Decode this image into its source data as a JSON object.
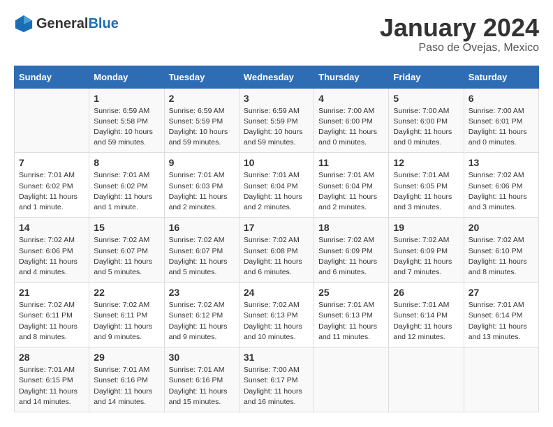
{
  "logo": {
    "general": "General",
    "blue": "Blue"
  },
  "title": "January 2024",
  "location": "Paso de Ovejas, Mexico",
  "weekdays": [
    "Sunday",
    "Monday",
    "Tuesday",
    "Wednesday",
    "Thursday",
    "Friday",
    "Saturday"
  ],
  "weeks": [
    [
      {
        "day": "",
        "info": ""
      },
      {
        "day": "1",
        "info": "Sunrise: 6:59 AM\nSunset: 5:58 PM\nDaylight: 10 hours\nand 59 minutes."
      },
      {
        "day": "2",
        "info": "Sunrise: 6:59 AM\nSunset: 5:59 PM\nDaylight: 10 hours\nand 59 minutes."
      },
      {
        "day": "3",
        "info": "Sunrise: 6:59 AM\nSunset: 5:59 PM\nDaylight: 10 hours\nand 59 minutes."
      },
      {
        "day": "4",
        "info": "Sunrise: 7:00 AM\nSunset: 6:00 PM\nDaylight: 11 hours\nand 0 minutes."
      },
      {
        "day": "5",
        "info": "Sunrise: 7:00 AM\nSunset: 6:00 PM\nDaylight: 11 hours\nand 0 minutes."
      },
      {
        "day": "6",
        "info": "Sunrise: 7:00 AM\nSunset: 6:01 PM\nDaylight: 11 hours\nand 0 minutes."
      }
    ],
    [
      {
        "day": "7",
        "info": "Sunrise: 7:01 AM\nSunset: 6:02 PM\nDaylight: 11 hours\nand 1 minute."
      },
      {
        "day": "8",
        "info": "Sunrise: 7:01 AM\nSunset: 6:02 PM\nDaylight: 11 hours\nand 1 minute."
      },
      {
        "day": "9",
        "info": "Sunrise: 7:01 AM\nSunset: 6:03 PM\nDaylight: 11 hours\nand 2 minutes."
      },
      {
        "day": "10",
        "info": "Sunrise: 7:01 AM\nSunset: 6:04 PM\nDaylight: 11 hours\nand 2 minutes."
      },
      {
        "day": "11",
        "info": "Sunrise: 7:01 AM\nSunset: 6:04 PM\nDaylight: 11 hours\nand 2 minutes."
      },
      {
        "day": "12",
        "info": "Sunrise: 7:01 AM\nSunset: 6:05 PM\nDaylight: 11 hours\nand 3 minutes."
      },
      {
        "day": "13",
        "info": "Sunrise: 7:02 AM\nSunset: 6:06 PM\nDaylight: 11 hours\nand 3 minutes."
      }
    ],
    [
      {
        "day": "14",
        "info": "Sunrise: 7:02 AM\nSunset: 6:06 PM\nDaylight: 11 hours\nand 4 minutes."
      },
      {
        "day": "15",
        "info": "Sunrise: 7:02 AM\nSunset: 6:07 PM\nDaylight: 11 hours\nand 5 minutes."
      },
      {
        "day": "16",
        "info": "Sunrise: 7:02 AM\nSunset: 6:07 PM\nDaylight: 11 hours\nand 5 minutes."
      },
      {
        "day": "17",
        "info": "Sunrise: 7:02 AM\nSunset: 6:08 PM\nDaylight: 11 hours\nand 6 minutes."
      },
      {
        "day": "18",
        "info": "Sunrise: 7:02 AM\nSunset: 6:09 PM\nDaylight: 11 hours\nand 6 minutes."
      },
      {
        "day": "19",
        "info": "Sunrise: 7:02 AM\nSunset: 6:09 PM\nDaylight: 11 hours\nand 7 minutes."
      },
      {
        "day": "20",
        "info": "Sunrise: 7:02 AM\nSunset: 6:10 PM\nDaylight: 11 hours\nand 8 minutes."
      }
    ],
    [
      {
        "day": "21",
        "info": "Sunrise: 7:02 AM\nSunset: 6:11 PM\nDaylight: 11 hours\nand 8 minutes."
      },
      {
        "day": "22",
        "info": "Sunrise: 7:02 AM\nSunset: 6:11 PM\nDaylight: 11 hours\nand 9 minutes."
      },
      {
        "day": "23",
        "info": "Sunrise: 7:02 AM\nSunset: 6:12 PM\nDaylight: 11 hours\nand 9 minutes."
      },
      {
        "day": "24",
        "info": "Sunrise: 7:02 AM\nSunset: 6:13 PM\nDaylight: 11 hours\nand 10 minutes."
      },
      {
        "day": "25",
        "info": "Sunrise: 7:01 AM\nSunset: 6:13 PM\nDaylight: 11 hours\nand 11 minutes."
      },
      {
        "day": "26",
        "info": "Sunrise: 7:01 AM\nSunset: 6:14 PM\nDaylight: 11 hours\nand 12 minutes."
      },
      {
        "day": "27",
        "info": "Sunrise: 7:01 AM\nSunset: 6:14 PM\nDaylight: 11 hours\nand 13 minutes."
      }
    ],
    [
      {
        "day": "28",
        "info": "Sunrise: 7:01 AM\nSunset: 6:15 PM\nDaylight: 11 hours\nand 14 minutes."
      },
      {
        "day": "29",
        "info": "Sunrise: 7:01 AM\nSunset: 6:16 PM\nDaylight: 11 hours\nand 14 minutes."
      },
      {
        "day": "30",
        "info": "Sunrise: 7:01 AM\nSunset: 6:16 PM\nDaylight: 11 hours\nand 15 minutes."
      },
      {
        "day": "31",
        "info": "Sunrise: 7:00 AM\nSunset: 6:17 PM\nDaylight: 11 hours\nand 16 minutes."
      },
      {
        "day": "",
        "info": ""
      },
      {
        "day": "",
        "info": ""
      },
      {
        "day": "",
        "info": ""
      }
    ]
  ]
}
